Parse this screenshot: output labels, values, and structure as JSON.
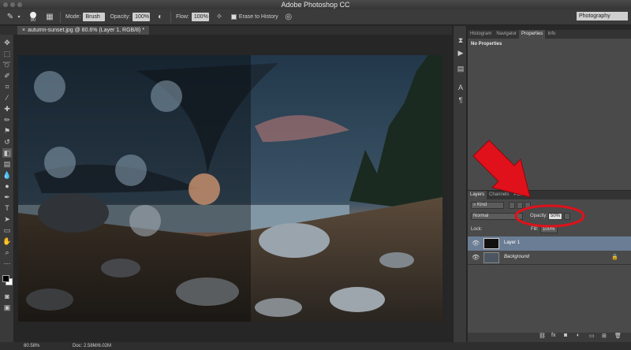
{
  "app": {
    "title": "Adobe Photoshop CC"
  },
  "options_bar": {
    "brush_size": "90",
    "mode_label": "Mode:",
    "mode_value": "Brush",
    "opacity_label": "Opacity:",
    "opacity_value": "100%",
    "flow_label": "Flow:",
    "flow_value": "100%",
    "erase_history_label": "Erase to History",
    "workspace": "Photography"
  },
  "document": {
    "tab_title": "autumn-sunset.jpg @ 80.6% (Layer 1, RGB/8) *"
  },
  "properties_panel": {
    "tabs": [
      "Histogram",
      "Navigator",
      "Properties",
      "Info"
    ],
    "active_tab": "Properties",
    "content": "No Properties"
  },
  "layers_panel": {
    "tabs": [
      "Layers",
      "Channels",
      "Paths"
    ],
    "filter_kind": "Kind",
    "blend_mode": "Normal",
    "opacity_label": "Opacity:",
    "opacity_value": "50%",
    "lock_label": "Lock:",
    "fill_label": "Fill:",
    "fill_value": "100%",
    "layers": [
      {
        "name": "Layer 1",
        "selected": true,
        "locked": false
      },
      {
        "name": "Background",
        "selected": false,
        "locked": true
      }
    ]
  },
  "status_bar": {
    "zoom": "80.58%",
    "doc_info": "Doc: 2.58M/6.02M"
  },
  "colors": {
    "highlight_red": "#e0111b",
    "selected_layer": "#6b7d95"
  }
}
